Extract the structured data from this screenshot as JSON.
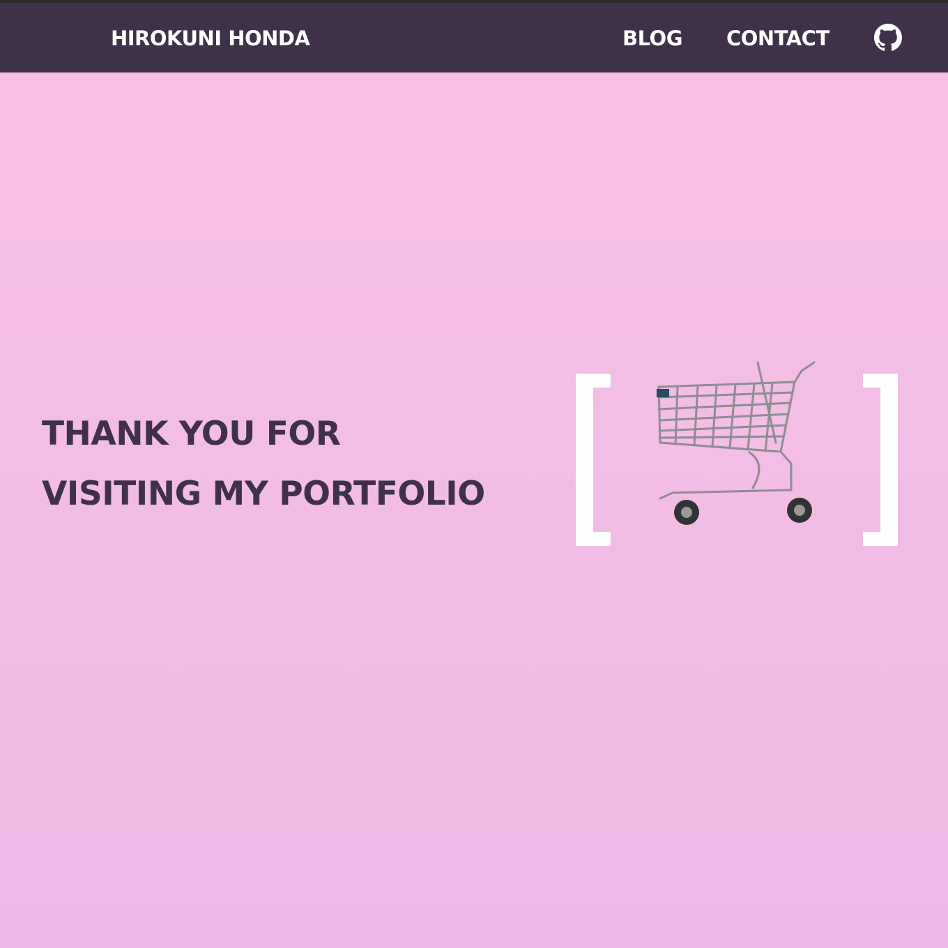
{
  "nav": {
    "brand": "HIROKUNI HONDA",
    "links": [
      {
        "label": "BLOG"
      },
      {
        "label": "CONTACT"
      }
    ],
    "github_icon": "github-icon"
  },
  "hero": {
    "line1": "THANK YOU FOR",
    "line2": "VISITING MY PORTFOLIO",
    "illustration": "shopping-cart-icon"
  },
  "colors": {
    "nav_bg": "#3e3149",
    "text": "#3e3149",
    "bg_top": "#f8c1e7",
    "bg_bottom": "#ebb9e4"
  }
}
